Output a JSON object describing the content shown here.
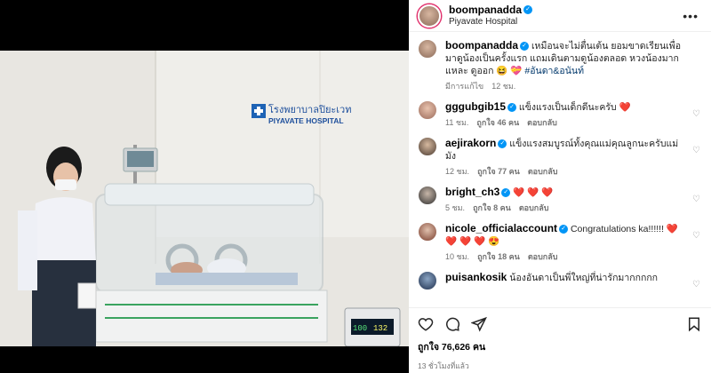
{
  "post": {
    "username": "boompanadda",
    "location": "Piyavate Hospital",
    "caption_user": "boompanadda",
    "caption_text": "เหมือนจะไม่ตื่นเต้น ยอมขาดเรียนเพื่อมาดูน้องเป็นครั้งแรก แถมเดินตามดูน้องตลอด หวงน้องมากแหละ ดูออก 😆 💝",
    "caption_tags": "#อันดา&อนันท์",
    "caption_edited": "มีการแก้ไข",
    "caption_time": "12 ชม.",
    "likes": "ถูกใจ 76,626 คน",
    "posted_ago": "13 ชั่วโมงที่แล้ว",
    "more_icon": "more-horizontal-icon",
    "hospital_sign_thai": "โรงพยาบาลปิยะเวท",
    "hospital_sign_en": "PIYAVATE HOSPITAL",
    "monitor_readout_1": "100",
    "monitor_readout_2": "132"
  },
  "comments": [
    {
      "user": "gggubgib15",
      "verified": true,
      "text": "แข็งแรงเป็นเด็กดีนะครับ ❤️",
      "time": "11 ชม.",
      "likes": "ถูกใจ 46 คน",
      "reply": "ตอบกลับ"
    },
    {
      "user": "aejirakorn",
      "verified": true,
      "text": "แข็งแรงสมบูรณ์ทั้งคุณแม่คุณลูกนะครับแม่มัง",
      "time": "12 ชม.",
      "likes": "ถูกใจ 77 คน",
      "reply": "ตอบกลับ"
    },
    {
      "user": "bright_ch3",
      "verified": true,
      "text": "❤️ ❤️ ❤️",
      "time": "5 ชม.",
      "likes": "ถูกใจ 8 คน",
      "reply": "ตอบกลับ"
    },
    {
      "user": "nicole_officialaccount",
      "verified": true,
      "text": "Congratulations ka!!!!!! ❤️ ❤️ ❤️ ❤️ 😍",
      "time": "10 ชม.",
      "likes": "ถูกใจ 18 คน",
      "reply": "ตอบกลับ"
    },
    {
      "user": "puisankosik",
      "verified": false,
      "text": "น้องอันดาเป็นพี่ใหญ่ที่น่ารักมากกกกก",
      "time": "",
      "likes": "",
      "reply": ""
    }
  ],
  "colors": {
    "verified": "#0095f6",
    "link": "#00376b",
    "story_ring": "#e1306c"
  }
}
